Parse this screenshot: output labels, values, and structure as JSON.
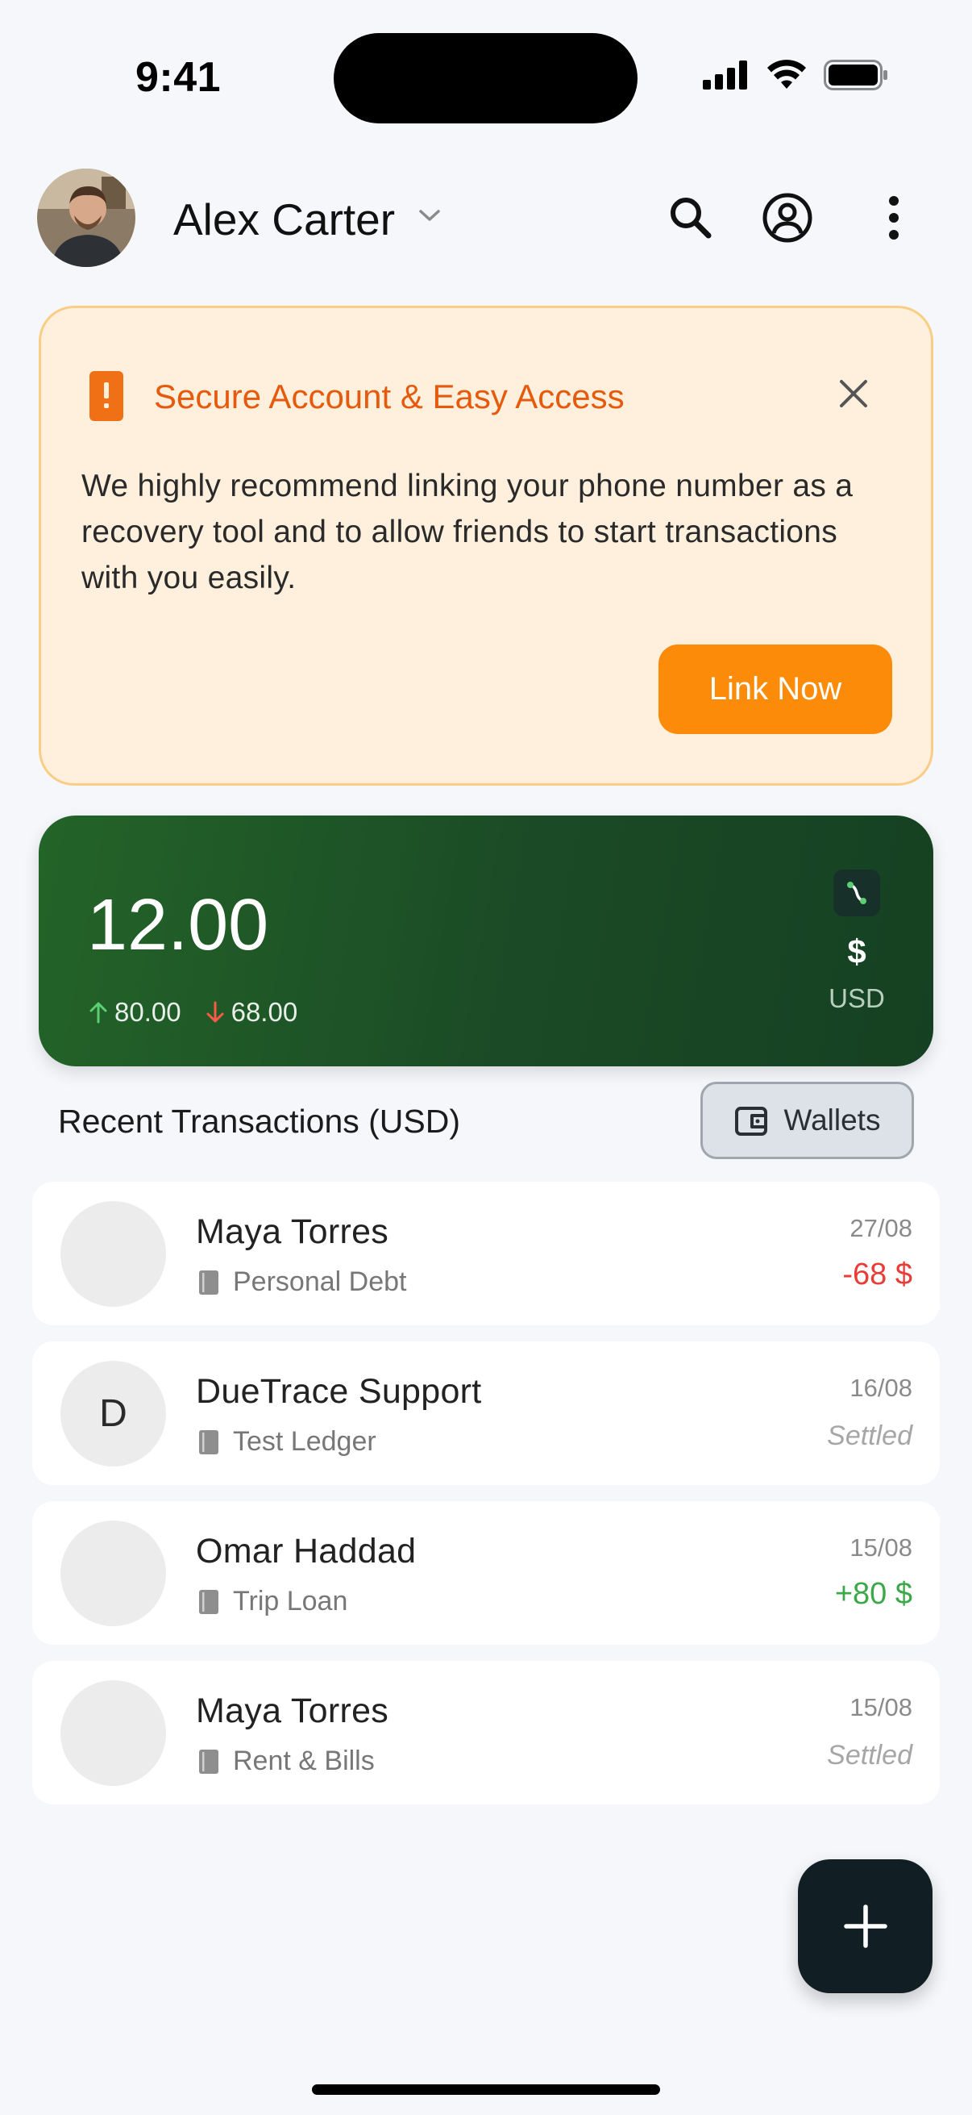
{
  "status_bar": {
    "time": "9:41"
  },
  "header": {
    "user_name": "Alex Carter",
    "icons": [
      "search-icon",
      "account-circle-icon",
      "more-vertical-icon"
    ]
  },
  "banner": {
    "title": "Secure Account & Easy Access",
    "body": "We highly recommend linking your phone number as a recovery tool and to allow friends to start transactions with you easily.",
    "button_label": "Link Now"
  },
  "balance_card": {
    "balance": "12.00",
    "incoming": "80.00",
    "outgoing": "68.00",
    "currency_symbol": "$",
    "currency_code": "USD"
  },
  "transactions_section": {
    "title": "Recent Transactions (USD)",
    "wallets_label": "Wallets"
  },
  "transactions": [
    {
      "initial": "",
      "name": "Maya Torres",
      "ledger": "Personal Debt",
      "date": "27/08",
      "amount": "-68 $",
      "status": "negative"
    },
    {
      "initial": "D",
      "name": "DueTrace Support",
      "ledger": "Test Ledger",
      "date": "16/08",
      "amount": "Settled",
      "status": "settled"
    },
    {
      "initial": "",
      "name": "Omar Haddad",
      "ledger": "Trip Loan",
      "date": "15/08",
      "amount": "+80 $",
      "status": "positive"
    },
    {
      "initial": "",
      "name": "Maya Torres",
      "ledger": "Rent & Bills",
      "date": "15/08",
      "amount": "Settled",
      "status": "settled"
    }
  ],
  "colors": {
    "accent_orange": "#fb8b08",
    "banner_title": "#e55a0c",
    "card_green": "#1b4a26",
    "negative": "#ea3c36",
    "positive": "#3da84a"
  }
}
